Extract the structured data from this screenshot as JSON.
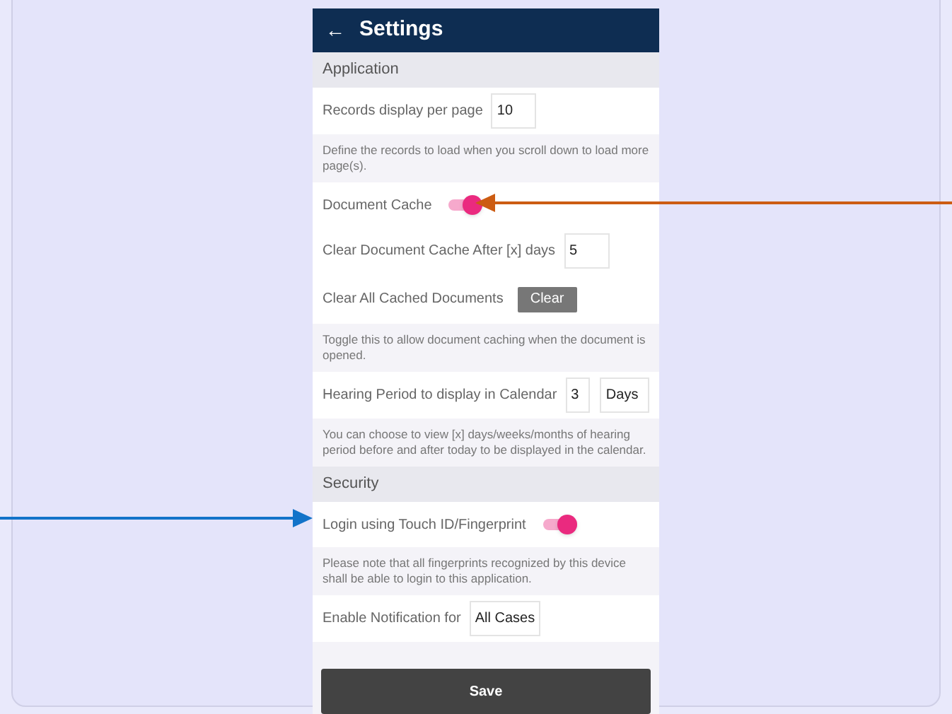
{
  "header": {
    "back": "←",
    "title": "Settings"
  },
  "items": [
    {
      "kind": "section",
      "label": "Application"
    },
    {
      "kind": "input",
      "label": "Records display per page",
      "value": "10"
    },
    {
      "kind": "hint",
      "text": "Define the records to load when you scroll down to load more page(s)."
    },
    {
      "kind": "toggle",
      "label": "Document Cache",
      "on": true
    },
    {
      "kind": "input",
      "label": "Clear Document Cache After [x] days",
      "value": "5"
    },
    {
      "kind": "button",
      "label": "Clear All Cached Documents",
      "button": "Clear"
    },
    {
      "kind": "hint",
      "text": "Toggle this to allow document caching when the document is opened."
    },
    {
      "kind": "double",
      "label": "Hearing Period to display in Calendar",
      "value": "3",
      "unit": "Days"
    },
    {
      "kind": "hint",
      "text": "You can choose to view [x] days/weeks/months of hearing period before and after today to be displayed in the calendar."
    },
    {
      "kind": "section",
      "label": "Security"
    },
    {
      "kind": "toggle",
      "label": "Login using Touch ID/Fingerprint",
      "on": true
    },
    {
      "kind": "hint",
      "text": "Please note that all fingerprints recognized by this device shall be able to login to this application."
    },
    {
      "kind": "input",
      "label": "Enable Notification for",
      "value": "All Cases"
    }
  ],
  "save": "Save"
}
